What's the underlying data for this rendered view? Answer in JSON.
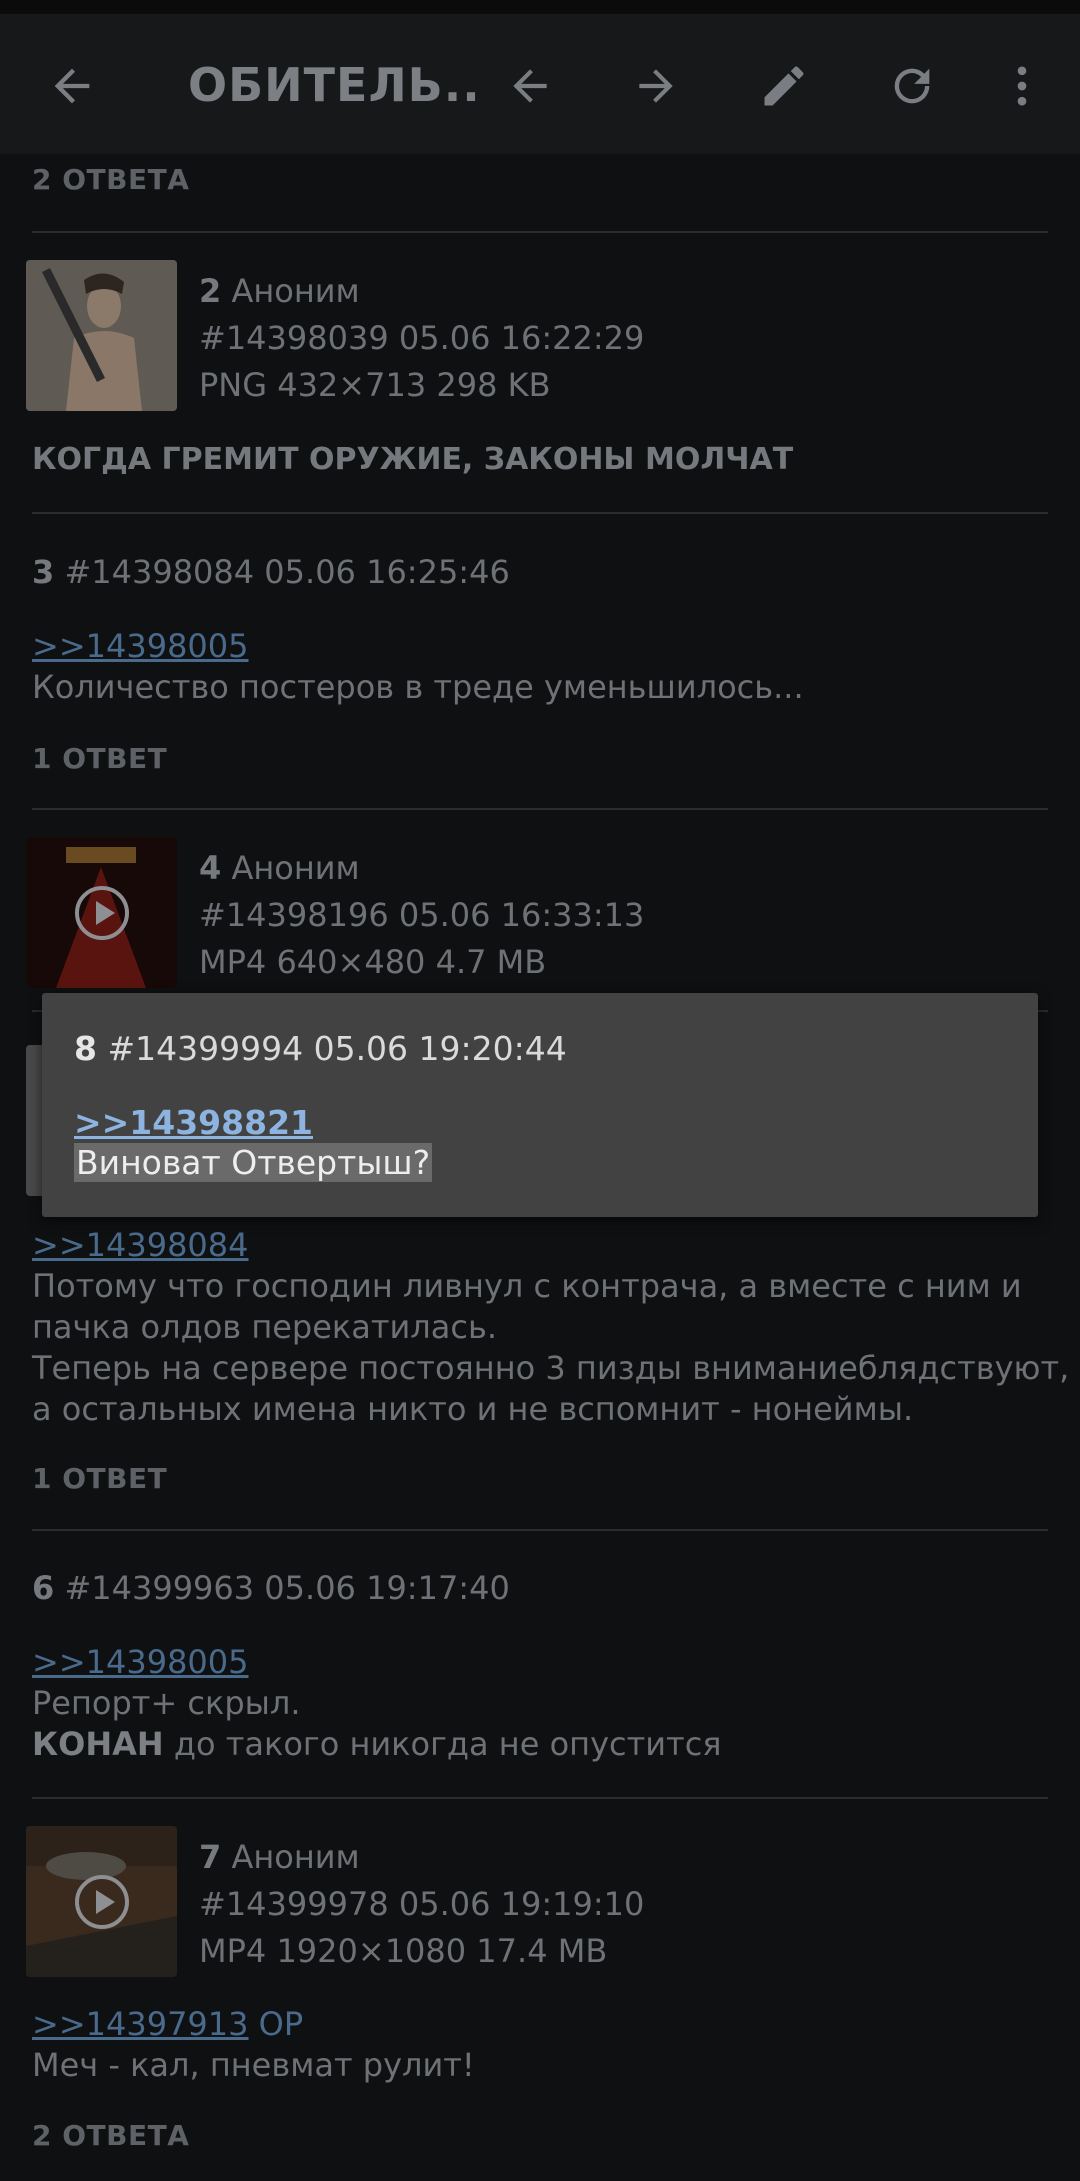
{
  "toolbar": {
    "title": "ОБИТЕЛЬ...",
    "back_icon": "arrow-left-icon",
    "prev_icon": "arrow-left-icon",
    "next_icon": "arrow-right-icon",
    "edit_icon": "pencil-icon",
    "refresh_icon": "refresh-icon",
    "menu_icon": "more-vert-icon"
  },
  "top_replies": "2 ОТВЕТА",
  "post2": {
    "num": "2",
    "name": "Аноним",
    "id_date": "#14398039 05.06 16:22:29",
    "file": "PNG 432×713 298 KB",
    "subject": "КОГДА ГРЕМИТ ОРУЖИЕ, ЗАКОНЫ МОЛЧАТ"
  },
  "post3": {
    "num": "3",
    "id_date": "#14398084 05.06 16:25:46",
    "link": ">>14398005",
    "text": "Количество постеров в треде уменьшилось...",
    "replies": "1 ОТВЕТ"
  },
  "post4": {
    "num": "4",
    "name": "Аноним",
    "id_date": "#14398196 05.06 16:33:13",
    "file": "MP4 640×480 4.7 MB"
  },
  "post5": {
    "link": ">>14398084",
    "lines": [
      "Потому что господин ливнул с контрача, а вместе с ним и",
      "пачка олдов перекатилась.",
      "Теперь на сервере постоянно 3 пизды вниманиеблядствуют,",
      "а остальных имена никто и не вспомнит - нонеймы."
    ],
    "replies": "1 ОТВЕТ"
  },
  "post6": {
    "num": "6",
    "id_date": "#14399963 05.06 19:17:40",
    "link": ">>14398005",
    "line1": "Репорт+ скрыл.",
    "line2_bold": "КОНАН",
    "line2_rest": " до такого никогда не опустится"
  },
  "post7": {
    "num": "7",
    "name": "Аноним",
    "id_date": "#14399978 05.06 19:19:10",
    "file": "MP4 1920×1080 17.4 MB",
    "link": ">>14397913",
    "op": " OP",
    "text": "Меч - кал, пневмат рулит!",
    "replies": "2 ОТВЕТА"
  },
  "popup": {
    "num": "8",
    "id_date": "#14399994 05.06 19:20:44",
    "link": ">>14398821",
    "text": "Виноват Отвертыш?"
  }
}
